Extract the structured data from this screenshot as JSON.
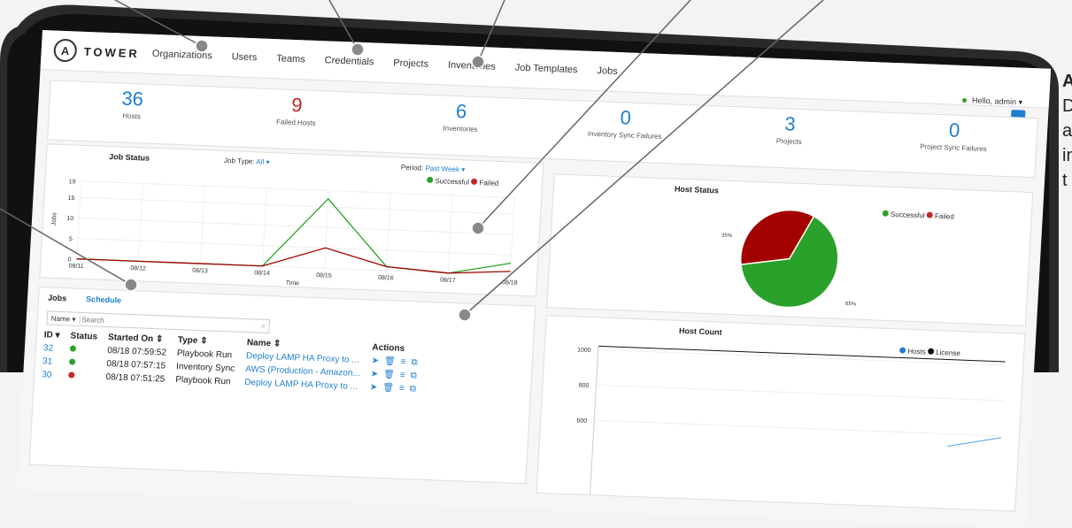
{
  "nav": {
    "brand": "TOWER",
    "logo_letter": "A",
    "items": [
      "Organizations",
      "Users",
      "Teams",
      "Credentials",
      "Projects",
      "Inventories",
      "Job Templates",
      "Jobs"
    ]
  },
  "user": {
    "greeting": "Hello, admin ▾"
  },
  "stats": [
    {
      "value": "36",
      "label": "Hosts"
    },
    {
      "value": "9",
      "label": "Failed Hosts"
    },
    {
      "value": "6",
      "label": "Inventories"
    },
    {
      "value": "0",
      "label": "Inventory Sync Failures"
    },
    {
      "value": "3",
      "label": "Projects"
    },
    {
      "value": "0",
      "label": "Project Sync Failures"
    }
  ],
  "job_status": {
    "title": "Job Status",
    "job_type_label": "Job Type:",
    "job_type_value": "All ▾",
    "period_label": "Period:",
    "period_value": "Past Week ▾",
    "legend": [
      "Successful",
      "Failed"
    ]
  },
  "host_status": {
    "title": "Host Status",
    "legend": [
      "Successful",
      "Failed"
    ],
    "failed_label": "35%",
    "success_label": "65%"
  },
  "host_count": {
    "title": "Host Count",
    "legend": [
      "Hosts",
      "License"
    ]
  },
  "jobs_panel": {
    "tabs": [
      "Jobs",
      "Schedule"
    ],
    "filter": "Name ▾",
    "search_placeholder": "Search",
    "columns": [
      "ID ▾",
      "Status",
      "Started On ⇕",
      "Type ⇕",
      "Name ⇕",
      "Actions"
    ],
    "rows": [
      {
        "id": "32",
        "status": "ok",
        "started": "08/18 07:59:52",
        "type": "Playbook Run",
        "name": "Deploy LAMP HA Proxy to ..."
      },
      {
        "id": "31",
        "status": "ok",
        "started": "08/18 07:57:15",
        "type": "Inventory Sync",
        "name": "AWS (Production - Amazon..."
      },
      {
        "id": "30",
        "status": "bad",
        "started": "08/18 07:51:25",
        "type": "Playbook Run",
        "name": "Deploy LAMP HA Proxy to ..."
      }
    ]
  },
  "side_text": [
    "A",
    "D",
    "a",
    "in",
    "t"
  ],
  "colors": {
    "accent": "#1f7fd1",
    "success": "#2aa12a",
    "failed": "#a30000",
    "bezel": "#2a2a2a"
  },
  "chart_data": [
    {
      "type": "line",
      "title": "Job Status",
      "xlabel": "Time",
      "ylabel": "Jobs",
      "categories": [
        "08/11",
        "08/12",
        "08/13",
        "08/14",
        "08/15",
        "08/16",
        "08/17",
        "08/18"
      ],
      "series": [
        {
          "name": "Successful",
          "values": [
            0,
            0,
            0,
            0,
            17,
            1,
            0,
            3
          ]
        },
        {
          "name": "Failed",
          "values": [
            0,
            0,
            0,
            0,
            5,
            1,
            0,
            1
          ]
        }
      ],
      "ylim": [
        0,
        19
      ],
      "yticks": [
        0,
        5,
        10,
        15,
        19
      ]
    },
    {
      "type": "pie",
      "title": "Host Status",
      "categories": [
        "Successful",
        "Failed"
      ],
      "values": [
        65,
        35
      ]
    },
    {
      "type": "line",
      "title": "Host Count",
      "ylabel": "Hosts",
      "series": [
        {
          "name": "Hosts"
        },
        {
          "name": "License"
        }
      ],
      "yticks": [
        600,
        800,
        1000
      ]
    }
  ]
}
